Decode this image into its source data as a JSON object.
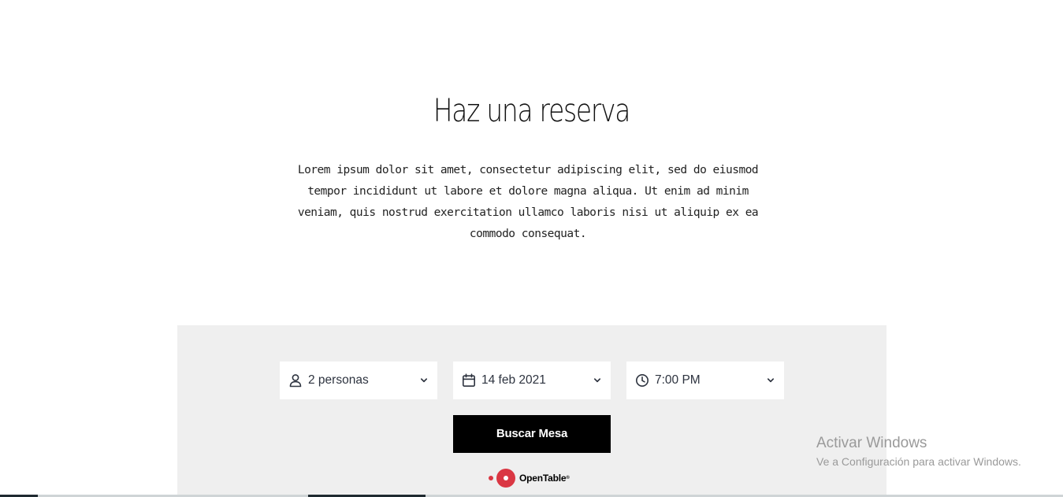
{
  "section": {
    "title": "Haz una reserva",
    "description": "Lorem ipsum dolor sit amet, consectetur adipiscing elit, sed do eiusmod tempor incididunt ut labore et dolore magna aliqua. Ut enim ad minim veniam, quis nostrud exercitation ullamco laboris nisi ut aliquip ex ea commodo consequat."
  },
  "reservation": {
    "party_size": "2 personas",
    "date": "14 feb 2021",
    "time": "7:00 PM",
    "search_button": "Buscar Mesa",
    "brand": "OpenTable",
    "brand_mark": "®",
    "icons": {
      "party": "user-icon",
      "date": "calendar-icon",
      "time": "clock-icon",
      "dropdown": "chevron-down-icon"
    },
    "colors": {
      "widget_bg": "#efefef",
      "button_bg": "#000000",
      "brand_red": "#da3743"
    }
  },
  "os_watermark": {
    "title": "Activar Windows",
    "subtitle": "Ve a Configuración para activar Windows."
  }
}
